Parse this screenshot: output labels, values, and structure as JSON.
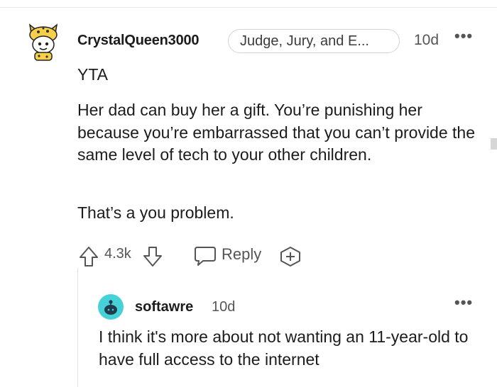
{
  "comment": {
    "username": "CrystalQueen3000",
    "flair": "Judge, Jury, and E...",
    "time": "10d",
    "paragraphs": [
      "YTA",
      "Her dad can buy her a gift. You’re punishing her because you’re embarrassed that you can’t provide the same level of tech to your other children.",
      "That’s a you problem."
    ],
    "score": "4.3k",
    "reply_label": "Reply",
    "more_label": "•••",
    "avatar_icon": "snoo-leopard-hat-avatar"
  },
  "reply": {
    "username": "softawre",
    "time": "10d",
    "body": "I think it's more about not wanting an 11-year-old to have full access to the internet",
    "more_label": "•••",
    "avatar_icon": "default-snoo-avatar",
    "avatar_color": "#46d1d8"
  },
  "colors": {
    "text": "#1c1c1c",
    "meta": "#555555",
    "divider": "#e2e2e2"
  }
}
